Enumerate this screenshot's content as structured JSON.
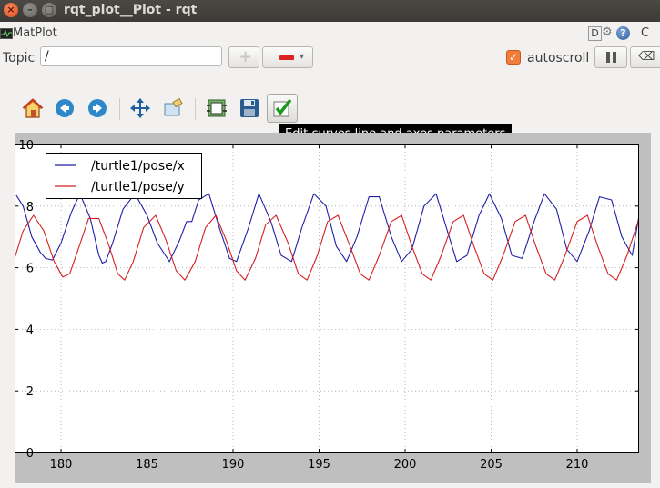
{
  "window": {
    "title": "rqt_plot__Plot - rqt"
  },
  "plugin": {
    "title": "MatPlot",
    "d_label": "D",
    "help_label": "?",
    "close_label": "C"
  },
  "topic": {
    "label": "Topic",
    "value": "/"
  },
  "autoscroll": {
    "label": "autoscroll",
    "checked": true
  },
  "toolbar": {
    "items": [
      "home-icon",
      "back-icon",
      "forward-icon",
      "pan-icon",
      "zoom-icon",
      "subplots-icon",
      "save-icon",
      "edit-curves-icon"
    ],
    "tooltip": "Edit curves line and axes parameters"
  },
  "colors": {
    "accent": "#f07c3e",
    "series_x": "#1f1fa8",
    "series_y": "#d42020"
  },
  "chart_data": {
    "type": "line",
    "xlim": [
      177.3,
      213.6
    ],
    "ylim": [
      0,
      10
    ],
    "xticks": [
      180,
      185,
      190,
      195,
      200,
      205,
      210
    ],
    "yticks": [
      0,
      2,
      4,
      6,
      8,
      10
    ],
    "grid": true,
    "legend": "top-left",
    "series": [
      {
        "name": "/turtle1/pose/x",
        "color": "#1f1fa8",
        "points": [
          [
            177.4,
            8.35
          ],
          [
            177.8,
            8.0
          ],
          [
            178.3,
            7.0
          ],
          [
            178.8,
            6.5
          ],
          [
            179.1,
            6.3
          ],
          [
            179.5,
            6.25
          ],
          [
            180.0,
            6.8
          ],
          [
            180.6,
            7.8
          ],
          [
            181.1,
            8.4
          ],
          [
            181.7,
            7.6
          ],
          [
            182.2,
            6.4
          ],
          [
            182.4,
            6.15
          ],
          [
            182.6,
            6.2
          ],
          [
            183.0,
            6.8
          ],
          [
            183.6,
            7.9
          ],
          [
            184.3,
            8.4
          ],
          [
            185.0,
            7.7
          ],
          [
            185.6,
            6.8
          ],
          [
            186.3,
            6.2
          ],
          [
            186.9,
            6.9
          ],
          [
            187.3,
            7.5
          ],
          [
            187.6,
            7.5
          ],
          [
            188.0,
            8.2
          ],
          [
            188.6,
            8.4
          ],
          [
            189.2,
            7.3
          ],
          [
            189.8,
            6.3
          ],
          [
            190.2,
            6.2
          ],
          [
            190.9,
            7.3
          ],
          [
            191.5,
            8.4
          ],
          [
            192.2,
            7.5
          ],
          [
            192.8,
            6.4
          ],
          [
            193.4,
            6.2
          ],
          [
            194.0,
            7.3
          ],
          [
            194.7,
            8.4
          ],
          [
            195.4,
            8.0
          ],
          [
            196.0,
            6.7
          ],
          [
            196.6,
            6.2
          ],
          [
            197.2,
            7.0
          ],
          [
            197.9,
            8.3
          ],
          [
            198.5,
            8.3
          ],
          [
            199.2,
            7.0
          ],
          [
            199.8,
            6.2
          ],
          [
            200.4,
            6.6
          ],
          [
            201.1,
            8.0
          ],
          [
            201.8,
            8.4
          ],
          [
            202.4,
            7.3
          ],
          [
            203.0,
            6.2
          ],
          [
            203.6,
            6.4
          ],
          [
            204.3,
            7.7
          ],
          [
            204.9,
            8.4
          ],
          [
            205.6,
            7.6
          ],
          [
            206.2,
            6.4
          ],
          [
            206.8,
            6.3
          ],
          [
            207.5,
            7.5
          ],
          [
            208.1,
            8.4
          ],
          [
            208.8,
            7.9
          ],
          [
            209.4,
            6.6
          ],
          [
            210.0,
            6.2
          ],
          [
            210.7,
            7.2
          ],
          [
            211.3,
            8.3
          ],
          [
            212.0,
            8.2
          ],
          [
            212.6,
            7.0
          ],
          [
            213.2,
            6.4
          ],
          [
            213.6,
            7.7
          ]
        ]
      },
      {
        "name": "/turtle1/pose/y",
        "color": "#d42020",
        "points": [
          [
            177.3,
            6.3
          ],
          [
            177.8,
            7.2
          ],
          [
            178.4,
            7.7
          ],
          [
            179.0,
            7.2
          ],
          [
            179.6,
            6.2
          ],
          [
            180.1,
            5.7
          ],
          [
            180.5,
            5.8
          ],
          [
            181.0,
            6.6
          ],
          [
            181.6,
            7.6
          ],
          [
            182.2,
            7.6
          ],
          [
            182.8,
            6.7
          ],
          [
            183.3,
            5.8
          ],
          [
            183.7,
            5.6
          ],
          [
            184.2,
            6.2
          ],
          [
            184.8,
            7.3
          ],
          [
            185.5,
            7.7
          ],
          [
            186.1,
            6.9
          ],
          [
            186.7,
            5.9
          ],
          [
            187.2,
            5.6
          ],
          [
            187.8,
            6.2
          ],
          [
            188.4,
            7.3
          ],
          [
            189.0,
            7.7
          ],
          [
            189.6,
            6.9
          ],
          [
            190.2,
            5.9
          ],
          [
            190.7,
            5.6
          ],
          [
            191.3,
            6.3
          ],
          [
            191.9,
            7.4
          ],
          [
            192.5,
            7.7
          ],
          [
            193.2,
            6.8
          ],
          [
            193.8,
            5.8
          ],
          [
            194.3,
            5.6
          ],
          [
            194.9,
            6.4
          ],
          [
            195.5,
            7.5
          ],
          [
            196.1,
            7.7
          ],
          [
            196.8,
            6.7
          ],
          [
            197.4,
            5.8
          ],
          [
            197.9,
            5.6
          ],
          [
            198.5,
            6.4
          ],
          [
            199.2,
            7.5
          ],
          [
            199.8,
            7.7
          ],
          [
            200.4,
            6.7
          ],
          [
            201.0,
            5.8
          ],
          [
            201.5,
            5.6
          ],
          [
            202.1,
            6.4
          ],
          [
            202.8,
            7.5
          ],
          [
            203.4,
            7.7
          ],
          [
            204.0,
            6.7
          ],
          [
            204.6,
            5.8
          ],
          [
            205.1,
            5.6
          ],
          [
            205.7,
            6.4
          ],
          [
            206.4,
            7.5
          ],
          [
            207.0,
            7.7
          ],
          [
            207.6,
            6.7
          ],
          [
            208.2,
            5.8
          ],
          [
            208.7,
            5.6
          ],
          [
            209.3,
            6.4
          ],
          [
            210.0,
            7.5
          ],
          [
            210.6,
            7.7
          ],
          [
            211.2,
            6.7
          ],
          [
            211.8,
            5.8
          ],
          [
            212.3,
            5.6
          ],
          [
            212.9,
            6.4
          ],
          [
            213.6,
            7.6
          ]
        ]
      }
    ]
  }
}
